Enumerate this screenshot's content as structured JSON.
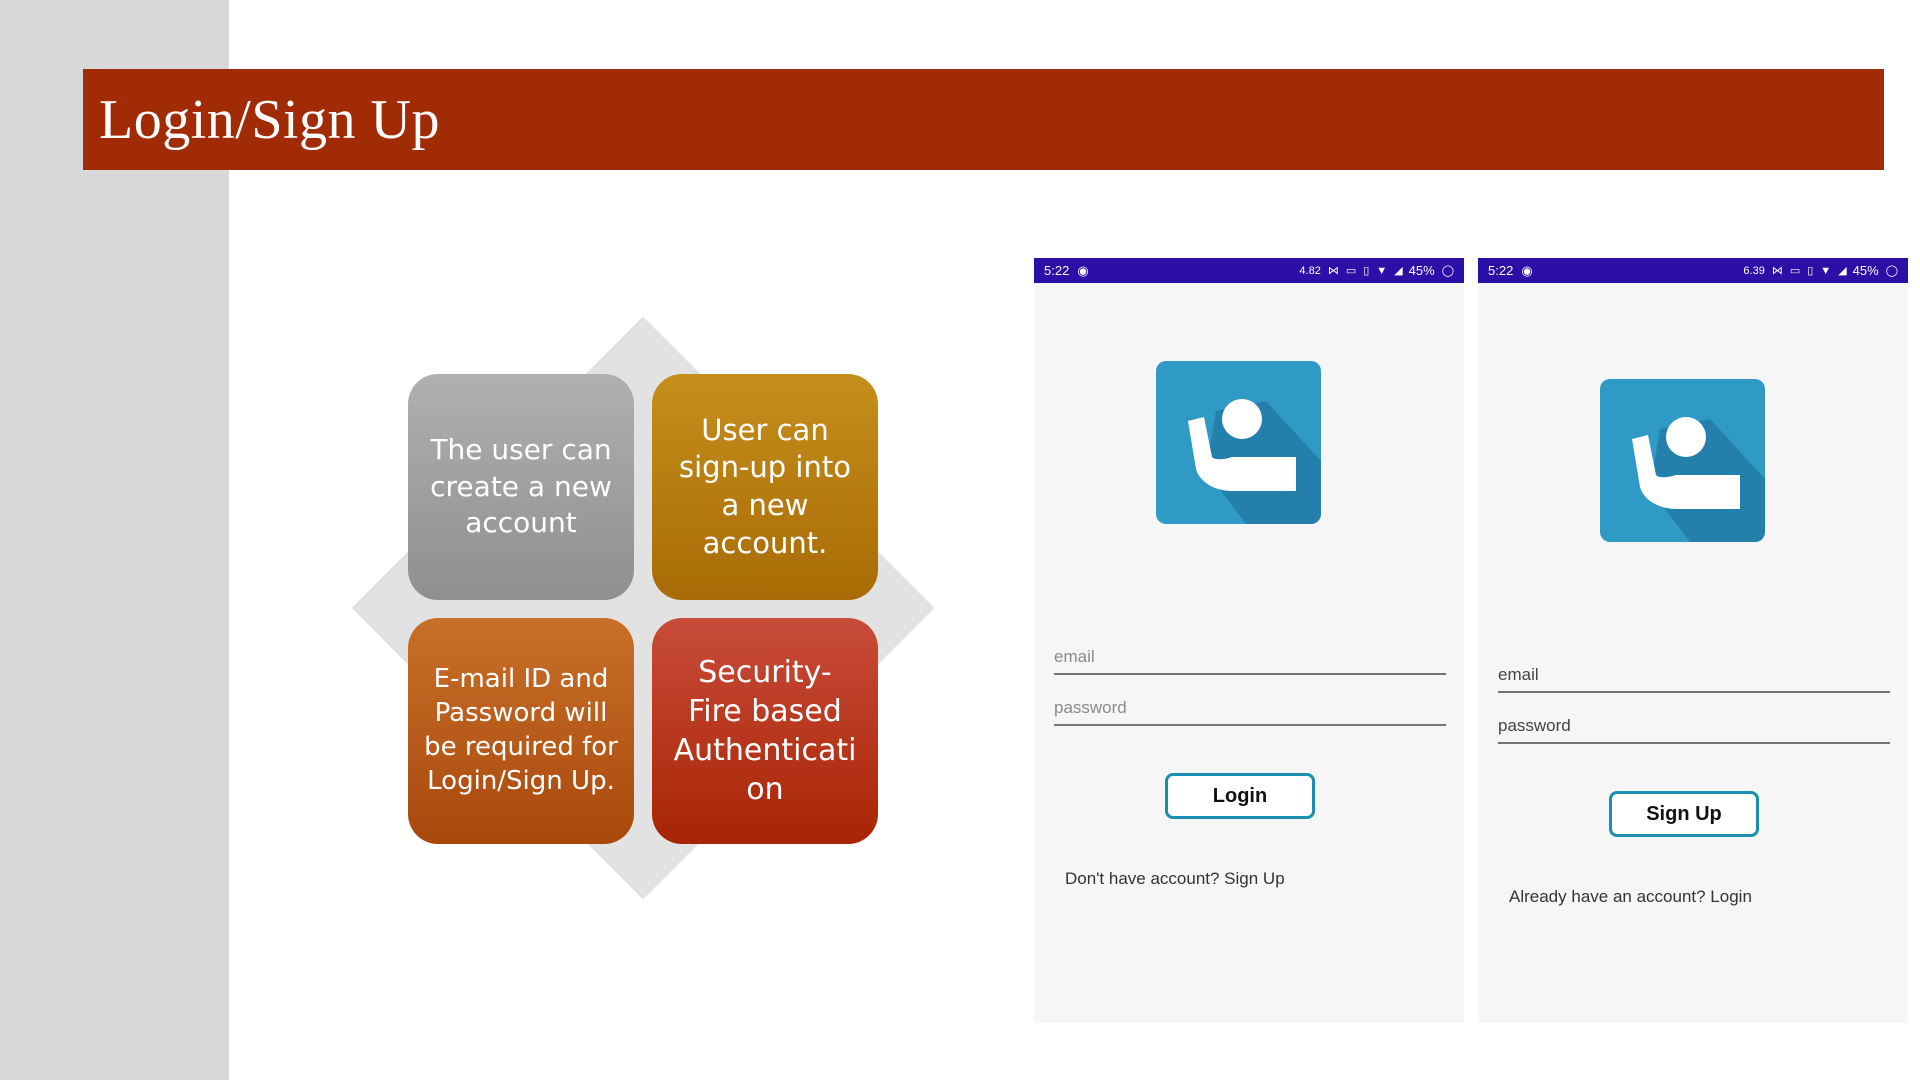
{
  "slide": {
    "title": "Login/Sign Up"
  },
  "diagram": {
    "quadrants": [
      {
        "text": "The user can\ncreate a new\naccount",
        "color": "#9e9e9e"
      },
      {
        "text": "User can\nsign-up into\na new\naccount.",
        "color": "#b37a0c"
      },
      {
        "text": "E-mail ID and\nPassword will\nbe required for\nLogin/Sign Up.",
        "color": "#b85a16"
      },
      {
        "text": "Security-\nFire based\nAuthenticati\non",
        "color": "#b3331a"
      }
    ]
  },
  "login_screen": {
    "status": {
      "time": "5:22",
      "net_speed": "4.82",
      "battery": "45%"
    },
    "app_icon": "hand-raise-icon",
    "email_placeholder": "email",
    "password_placeholder": "password",
    "button_label": "Login",
    "switch_text": "Don't have account? Sign Up"
  },
  "signup_screen": {
    "status": {
      "time": "5:22",
      "net_speed": "6.39",
      "battery": "45%"
    },
    "app_icon": "hand-raise-icon",
    "email_placeholder": "email",
    "password_placeholder": "password",
    "button_label": "Sign Up",
    "switch_text": "Already have an account? Login"
  },
  "colors": {
    "title_banner": "#a02b05",
    "status_bar": "#2c0fa6",
    "button_border": "#1b8fb0",
    "app_icon_bg": "#2f9ac6"
  }
}
